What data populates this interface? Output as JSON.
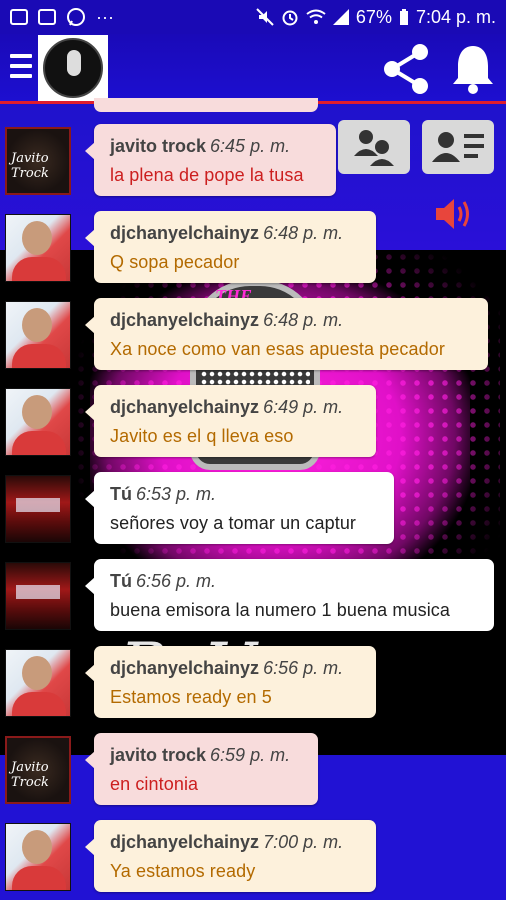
{
  "status_bar": {
    "battery": "67%",
    "time": "7:04 p. m.",
    "dots": "···"
  },
  "app_bar": {
    "menu_icon": "hamburger-icon",
    "share_icon": "share-icon",
    "bell_icon": "bell-icon"
  },
  "actions": {
    "group_icon": "users-group-icon",
    "card_icon": "user-card-icon",
    "speaker_icon": "speaker-volume-icon"
  },
  "background_art": {
    "badge_text": "THE",
    "script_text": "Rr Va"
  },
  "messages": [
    {
      "avatar": "javito",
      "avatar_text": "Javito Trock",
      "user": "javito trock",
      "time": "6:45 p. m.",
      "text": "la plena de pope la tusa",
      "style": "pink"
    },
    {
      "avatar": "dj",
      "user": "djchanyelchainyz",
      "time": "6:48 p. m.",
      "text": "Q sopa pecador",
      "style": "cream"
    },
    {
      "avatar": "dj",
      "user": "djchanyelchainyz",
      "time": "6:48 p. m.",
      "text": "Xa noce como van esas apuesta pecador",
      "style": "cream"
    },
    {
      "avatar": "dj",
      "user": "djchanyelchainyz",
      "time": "6:49 p. m.",
      "text": "Javito es el q lleva eso",
      "style": "cream"
    },
    {
      "avatar": "tu",
      "user": "Tú",
      "time": "6:53 p. m.",
      "text": "señores voy a tomar un captur",
      "style": "white"
    },
    {
      "avatar": "tu",
      "user": "Tú",
      "time": "6:56 p. m.",
      "text": "buena emisora la numero 1 buena musica",
      "style": "white"
    },
    {
      "avatar": "dj",
      "user": "djchanyelchainyz",
      "time": "6:56 p. m.",
      "text": "Estamos ready en 5",
      "style": "cream"
    },
    {
      "avatar": "javito",
      "avatar_text": "Javito Trock",
      "user": "javito trock",
      "time": "6:59 p. m.",
      "text": "en cintonia",
      "style": "pink"
    },
    {
      "avatar": "dj",
      "user": "djchanyelchainyz",
      "time": "7:00 p. m.",
      "text": "Ya estamos ready",
      "style": "cream"
    }
  ],
  "colors": {
    "app_bar": "#1a0ab8",
    "accent_line": "#e01d2d",
    "speaker": "#e8453c",
    "text_red": "#cc1f1f",
    "text_gold": "#b36a00"
  }
}
